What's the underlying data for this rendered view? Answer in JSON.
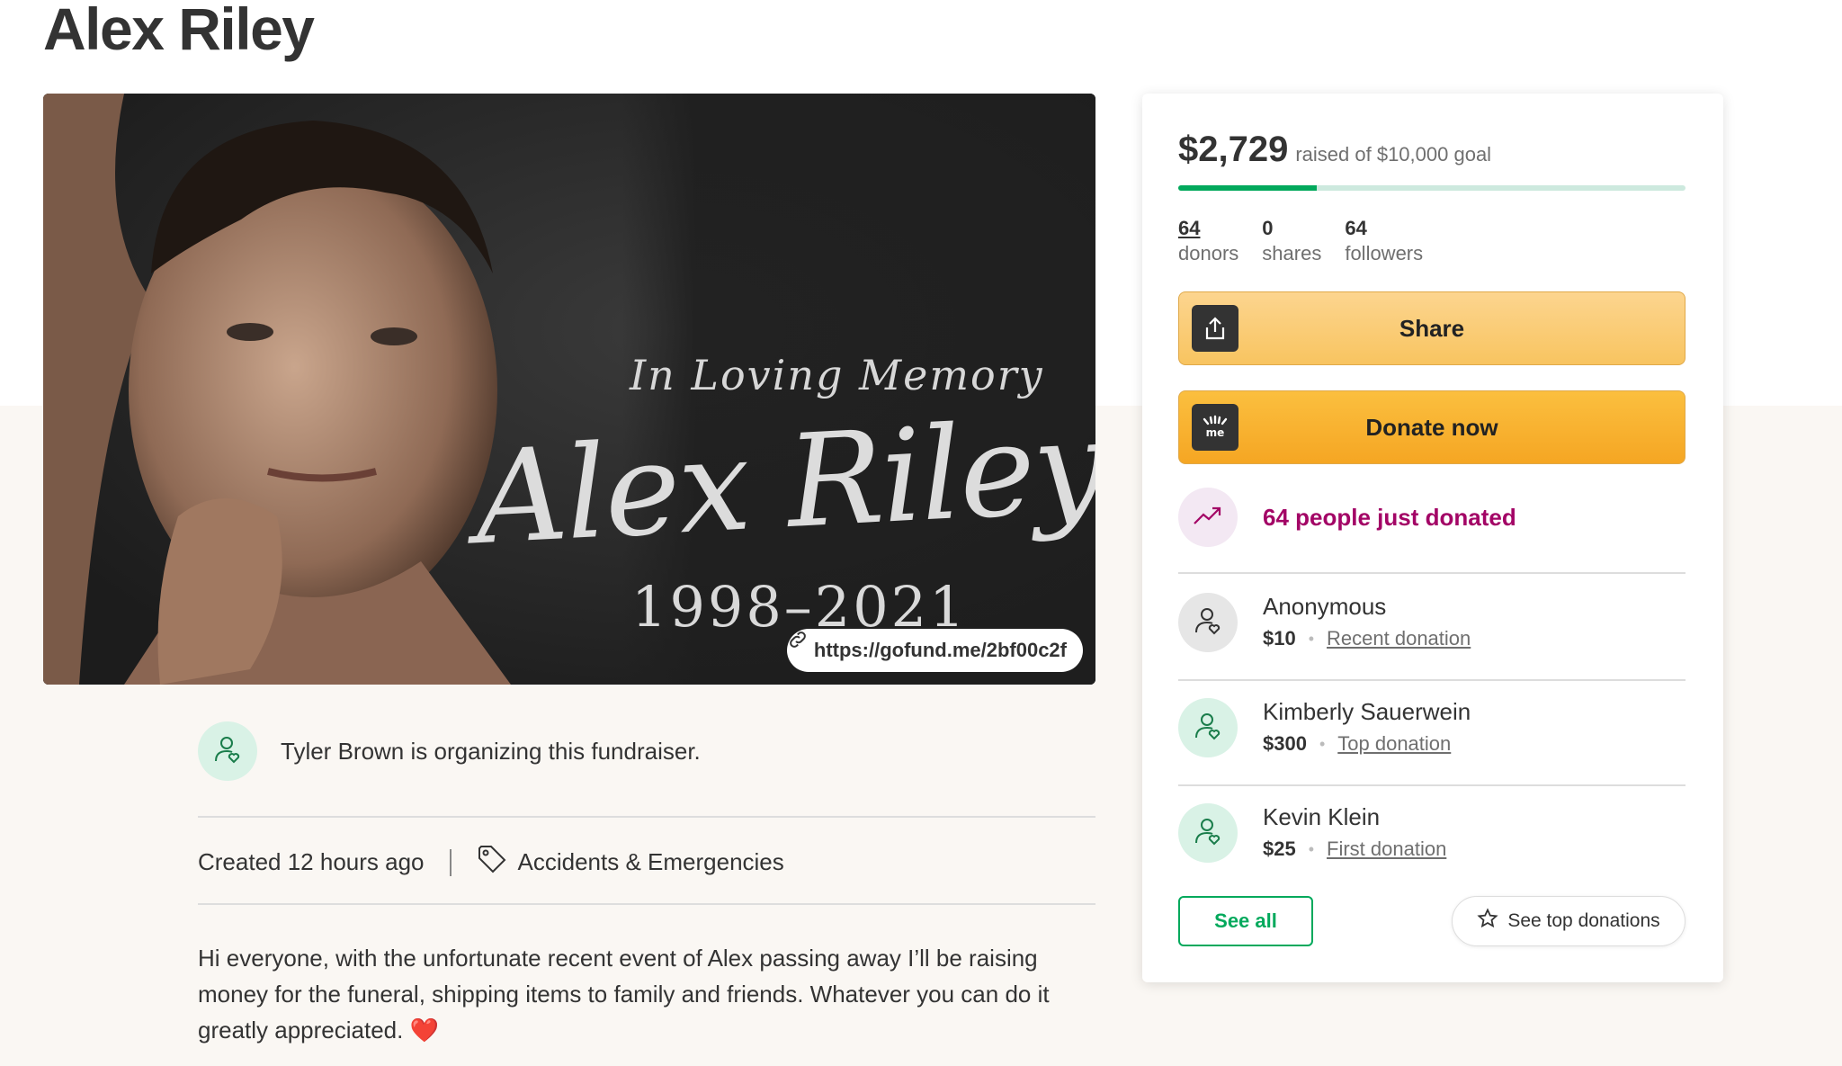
{
  "page": {
    "title": "Alex Riley"
  },
  "hero": {
    "memory_heading": "In Loving Memory",
    "memory_name": "Alex Riley",
    "memory_years": "1998–2021",
    "short_link": "https://gofund.me/2bf00c2f"
  },
  "organizer": {
    "text": "Tyler Brown is organizing this fundraiser."
  },
  "meta": {
    "created": "Created 12 hours ago",
    "category": "Accidents & Emergencies"
  },
  "story": {
    "text": "Hi everyone, with the unfortunate recent event of Alex passing away I’ll be raising money for the funeral, shipping items to family and friends. Whatever you can do it greatly appreciated. ❤️"
  },
  "sidebar": {
    "raised_amount": "$2,729",
    "goal_text": "raised of $10,000 goal",
    "progress_fraction": 0.2729,
    "progress_color": "#02a95c",
    "stats": {
      "donors_count": "64",
      "donors_label": "donors",
      "shares_count": "0",
      "shares_label": "shares",
      "followers_count": "64",
      "followers_label": "followers"
    },
    "share_label": "Share",
    "donate_label": "Donate now",
    "trend_text": "64 people just donated",
    "trend_color": "#a30566",
    "donations": [
      {
        "name": "Anonymous",
        "amount": "$10",
        "type": "Recent donation"
      },
      {
        "name": "Kimberly Sauerwein",
        "amount": "$300",
        "type": "Top donation"
      },
      {
        "name": "Kevin Klein",
        "amount": "$25",
        "type": "First donation"
      }
    ],
    "see_all_label": "See all",
    "see_top_label": "See top donations"
  }
}
